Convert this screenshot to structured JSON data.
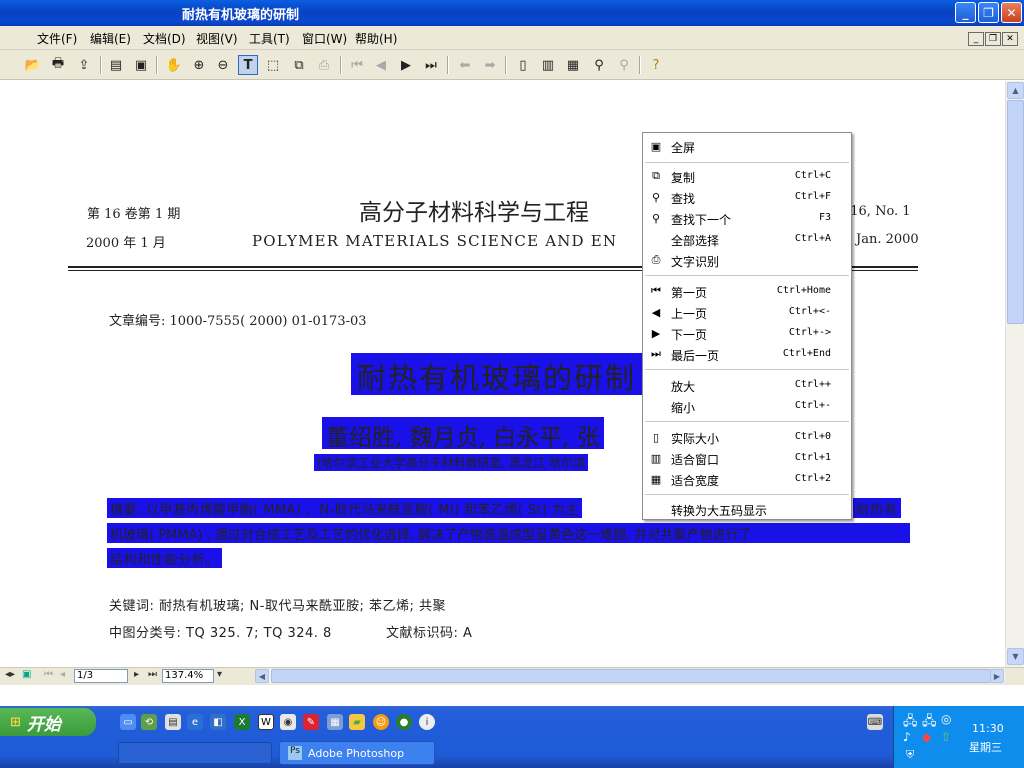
{
  "window": {
    "title": "耐热有机玻璃的研制"
  },
  "menu": [
    "文件(F)",
    "编辑(E)",
    "文档(D)",
    "视图(V)",
    "工具(T)",
    "窗口(W)",
    "帮助(H)"
  ],
  "document": {
    "header_left_line1": "第 16 卷第 1 期",
    "header_left_line2": "2000 年 1 月",
    "journal_cn": "高分子材料科学与工程",
    "journal_en": "POLYMER MATERIALS SCIENCE AND EN",
    "header_right_line1": ". 16, No. 1",
    "header_right_line2": "Jan.  2000",
    "article_no": "文章编号: 1000-7555( 2000) 01-0173-03",
    "title": "耐热有机玻璃的研制",
    "authors": "董绍胜, 魏月贞, 白永平, 张",
    "affiliation": "(哈尔滨工业大学高分子材料教研室, 黑龙江 哈尔滨",
    "abstract_line1_left": "摘要: 以甲基丙烯酸甲酯( MMA) 、N-取代马来酰亚胺( MI) 和苯乙烯( St) 为主",
    "abstract_line1_right": "耐热有",
    "abstract_line2": "机玻璃( PMMA) , 通过对合成工艺及工艺的优化选择, 解决了产物高温成型呈黄色这一难题, 并对共聚产物进行了",
    "abstract_line3": "结构和性能分析。",
    "keywords": "关键词: 耐热有机玻璃; N-取代马来酰亚胺; 苯乙烯; 共聚",
    "classification": "中图分类号: TQ 325. 7; TQ 324. 8",
    "doc_code": "文献标识码: A"
  },
  "context_menu": {
    "items": [
      {
        "label": "全屏",
        "shortcut": "",
        "icon": "fullscreen-icon"
      },
      {
        "label": "复制",
        "shortcut": "Ctrl+C",
        "icon": "copy-icon"
      },
      {
        "label": "查找",
        "shortcut": "Ctrl+F",
        "icon": "binoculars-icon"
      },
      {
        "label": "查找下一个",
        "shortcut": "F3",
        "icon": "find-next-icon"
      },
      {
        "label": "全部选择",
        "shortcut": "Ctrl+A",
        "icon": ""
      },
      {
        "label": "文字识别",
        "shortcut": "",
        "icon": "ocr-icon"
      },
      {
        "label": "第一页",
        "shortcut": "Ctrl+Home",
        "icon": "first-page-icon"
      },
      {
        "label": "上一页",
        "shortcut": "Ctrl+<-",
        "icon": "prev-page-icon"
      },
      {
        "label": "下一页",
        "shortcut": "Ctrl+->",
        "icon": "next-page-icon"
      },
      {
        "label": "最后一页",
        "shortcut": "Ctrl+End",
        "icon": "last-page-icon"
      },
      {
        "label": "放大",
        "shortcut": "Ctrl++",
        "icon": ""
      },
      {
        "label": "缩小",
        "shortcut": "Ctrl+-",
        "icon": ""
      },
      {
        "label": "实际大小",
        "shortcut": "Ctrl+0",
        "icon": "actual-size-icon"
      },
      {
        "label": "适合窗口",
        "shortcut": "Ctrl+1",
        "icon": "fit-window-icon"
      },
      {
        "label": "适合宽度",
        "shortcut": "Ctrl+2",
        "icon": "fit-width-icon"
      },
      {
        "label": "转换为大五码显示",
        "shortcut": "",
        "icon": ""
      }
    ]
  },
  "navbar": {
    "page": "1/3",
    "zoom": "137.4%"
  },
  "taskbar": {
    "start_label": "开始",
    "task_label": "Adobe Photoshop",
    "clock_time": "11:30",
    "clock_day": "星期三"
  },
  "colors": {
    "selection": "#1a10e8",
    "titlebar": "#0a54d8",
    "taskbar": "#245edb"
  }
}
